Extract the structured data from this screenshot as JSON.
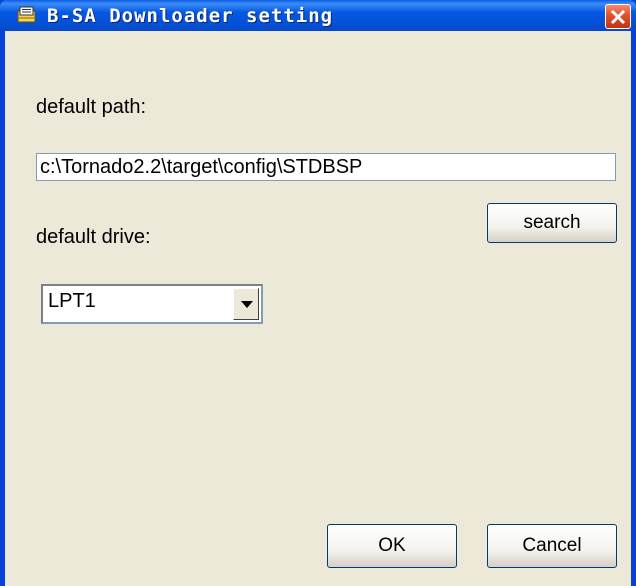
{
  "window": {
    "title": "B-SA Downloader setting",
    "icons": {
      "app": "app-document-icon",
      "close": "close-icon"
    },
    "colors": {
      "titlebar": "#0451d6",
      "close": "#e1512c",
      "background": "#ece9d8"
    }
  },
  "form": {
    "path_label": "default path:",
    "path_value": "c:\\Tornado2.2\\target\\config\\STDBSP",
    "search_label": "search",
    "drive_label": "default drive:",
    "drive_selected": "LPT1",
    "ok_label": "OK",
    "cancel_label": "Cancel"
  }
}
